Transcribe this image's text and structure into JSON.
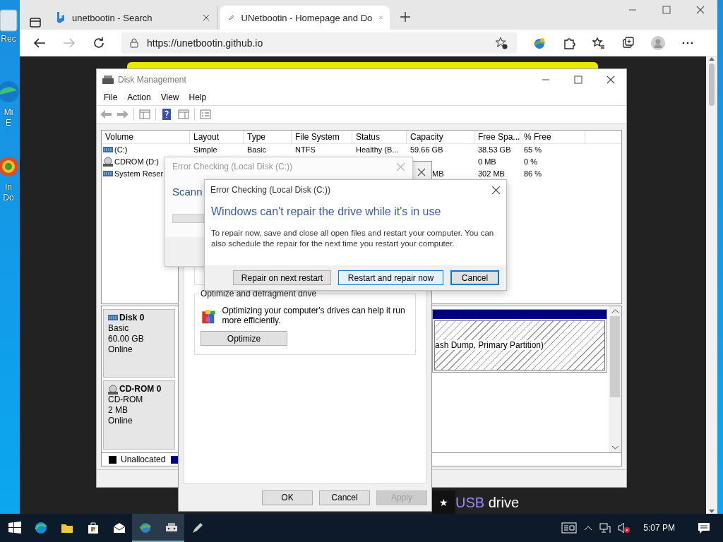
{
  "desktop_icons": [
    {
      "kind": "bin",
      "lines": [
        "Rec"
      ]
    },
    {
      "kind": "edge",
      "lines": [
        "Mi",
        "E"
      ]
    },
    {
      "kind": "app",
      "lines": [
        "In",
        "Do"
      ]
    }
  ],
  "browser": {
    "tabs": [
      {
        "title": "unetbootin - Search",
        "selected": false,
        "kind": "search"
      },
      {
        "title": "UNetbootin - Homepage and Do",
        "selected": true,
        "kind": "site"
      }
    ],
    "address": "https://unetbootin.github.io",
    "page": {
      "link": "USB",
      "heading_right": "drive",
      "star": "★"
    }
  },
  "disk_management": {
    "title": "Disk Management",
    "menu": [
      "File",
      "Action",
      "View",
      "Help"
    ],
    "columns": [
      "Volume",
      "Layout",
      "Type",
      "File System",
      "Status",
      "Capacity",
      "Free Spa...",
      "% Free"
    ],
    "volumes": [
      {
        "kind": "disk",
        "volume": "(C:)",
        "layout": "Simple",
        "type": "Basic",
        "file_system": "NTFS",
        "status": "Healthy (B...",
        "capacity": "59.66 GB",
        "free_space": "38.53 GB",
        "percent_free": "65 %"
      },
      {
        "kind": "cdrom",
        "volume": "CDROM (D:)",
        "free_space": "0 MB",
        "percent_free": "0 %"
      },
      {
        "kind": "disk",
        "volume": "System Reser",
        "capacity": "MB",
        "free_space": "302 MB",
        "percent_free": "86 %"
      }
    ],
    "disks": [
      {
        "kind": "disk",
        "name": "Disk 0",
        "lines": [
          "Basic",
          "60.00 GB",
          "Online"
        ],
        "partition": "ash Dump, Primary Partition)"
      },
      {
        "kind": "cdrom",
        "name": "CD-ROM 0",
        "lines": [
          "CD-ROM",
          "2 MB",
          "Online"
        ]
      }
    ],
    "legend": [
      {
        "label": "Unallocated",
        "color": "#000000"
      },
      {
        "color": "#000080"
      }
    ]
  },
  "properties": {
    "group_title": "Optimize and defragment drive",
    "group_text": "Optimizing your computer's drives can help it run more efficiently.",
    "optimize": "Optimize",
    "buttons": [
      {
        "label": "OK",
        "disabled": false
      },
      {
        "label": "Cancel",
        "disabled": false
      },
      {
        "label": "Apply",
        "disabled": true
      }
    ]
  },
  "scan_dialog": {
    "title": "Error Checking (Local Disk (C:))",
    "heading": "Scann",
    "progress": {
      "level": 0
    }
  },
  "repair_dialog": {
    "title": "Error Checking (Local Disk (C:))",
    "heading": "Windows can't repair the drive while it's in use",
    "message": "To repair now, save and close all open files and restart your computer. You can also schedule the repair for the next time you restart your computer.",
    "buttons": [
      {
        "label": "Repair on next restart",
        "focused": false,
        "hovered": false
      },
      {
        "label": "Restart and repair now",
        "focused": false,
        "hovered": true
      },
      {
        "label": "Cancel",
        "focused": true,
        "hovered": false
      }
    ]
  },
  "taskbar": {
    "time": "5:07 PM"
  }
}
